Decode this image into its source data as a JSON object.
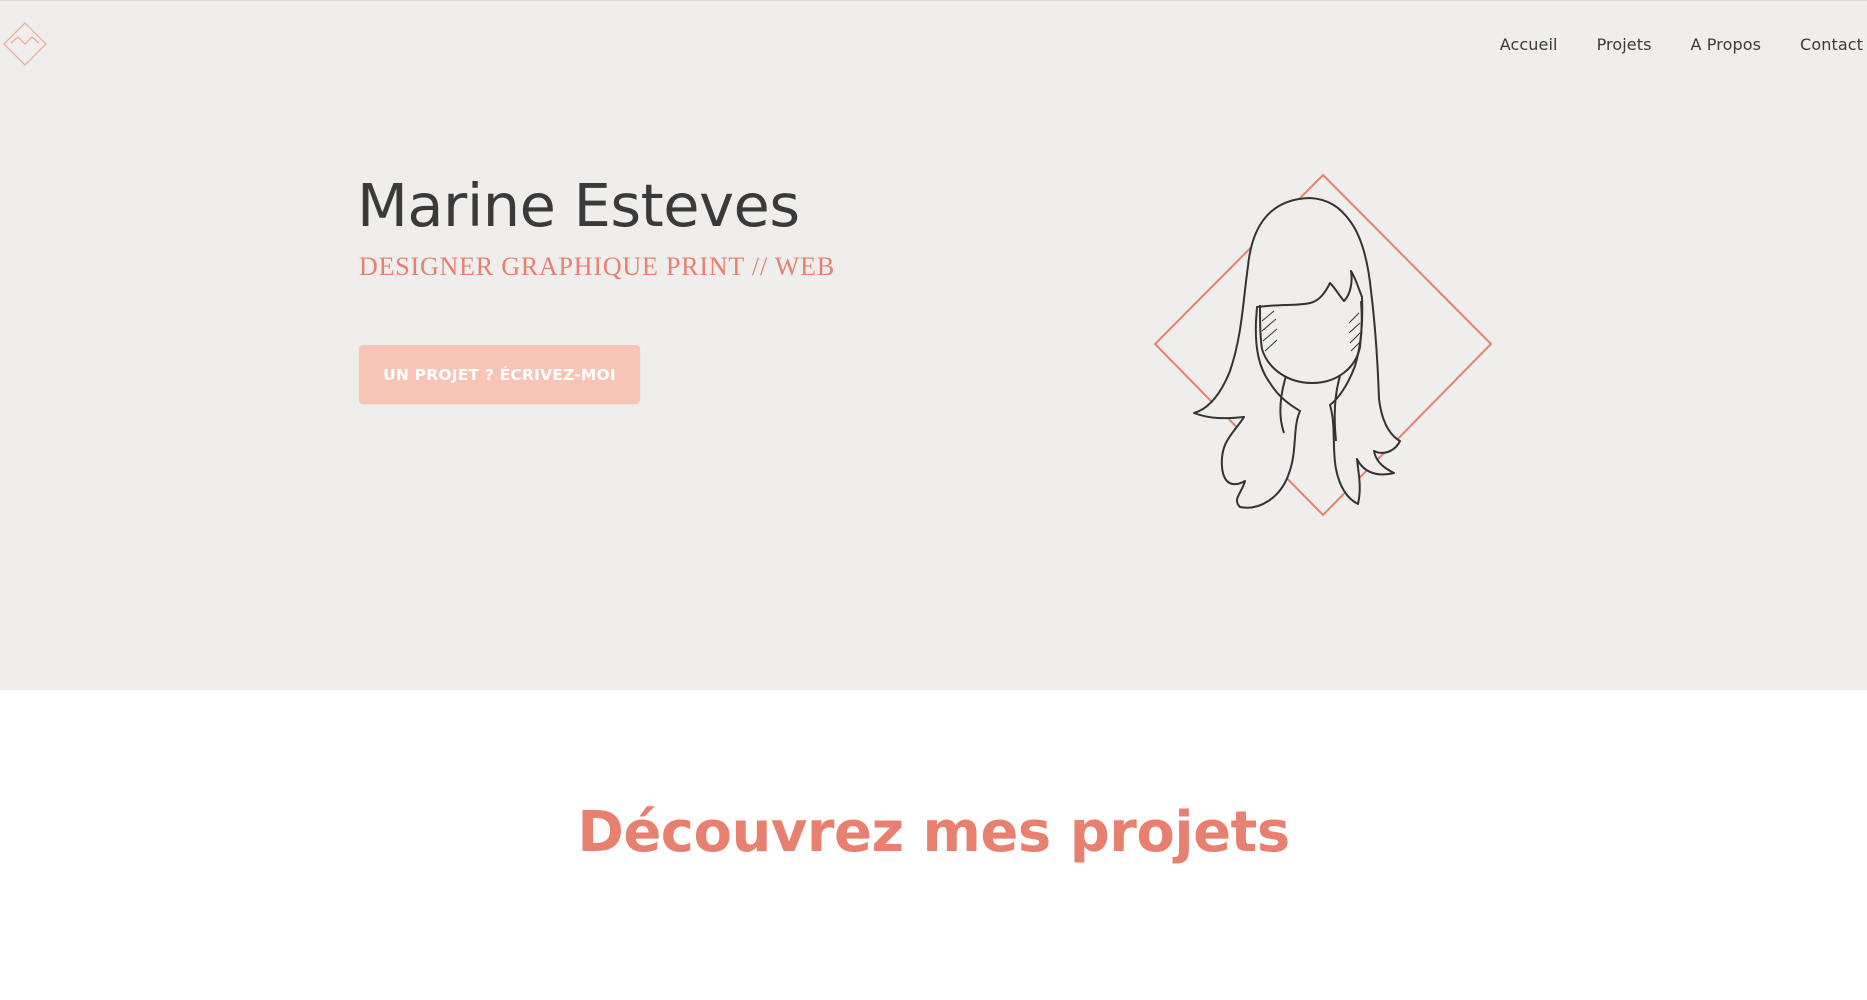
{
  "colors": {
    "accent": "#e8806f",
    "hero_bg": "#efeeec",
    "button_bg": "#f7c4b6",
    "text_dark": "#3a3a3a"
  },
  "header": {
    "logo_icon": "diamond-logo-icon",
    "nav": [
      {
        "label": "Accueil"
      },
      {
        "label": "Projets"
      },
      {
        "label": "A Propos"
      },
      {
        "label": "Contact"
      }
    ]
  },
  "hero": {
    "name": "Marine Esteves",
    "subtitle": "DESIGNER GRAPHIQUE PRINT // WEB",
    "cta_label": "UN PROJET ? ÉCRIVEZ-MOI",
    "illustration_icon": "woman-portrait-illustration"
  },
  "projects": {
    "title": "Découvrez mes projets"
  }
}
